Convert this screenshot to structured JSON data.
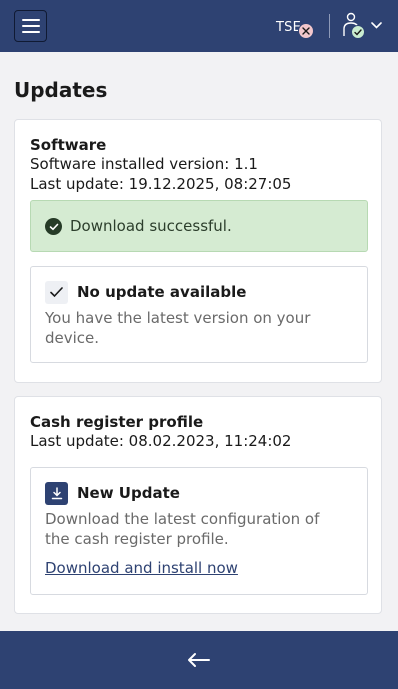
{
  "header": {
    "menu_icon": "hamburger-icon",
    "tse_label": "TSE",
    "tse_status_icon": "error-x-icon",
    "user_icon": "user-icon",
    "user_status_icon": "check-icon",
    "colors": {
      "bar": "#2e4272",
      "error": "#f2c7cc",
      "ok": "#c9ecd0"
    }
  },
  "page": {
    "title": "Updates"
  },
  "software": {
    "title": "Software",
    "installed_version": "Software installed version: 1.1",
    "last_update": "Last update: 19.12.2025, 08:27:05",
    "alert": {
      "message": "Download successful.",
      "icon": "success-check-icon",
      "color": "#d5ebd2"
    },
    "status": {
      "title": "No update available",
      "text": "You have the latest version on your device.",
      "icon": "checkmark-icon"
    }
  },
  "profile": {
    "title": "Cash register profile",
    "last_update": "Last update: 08.02.2023, 11:24:02",
    "update": {
      "title": "New Update",
      "text": "Download the latest configuration of the cash register profile.",
      "link": "Download and install now",
      "icon": "download-icon"
    }
  },
  "footer": {
    "back_icon": "arrow-left-icon"
  }
}
